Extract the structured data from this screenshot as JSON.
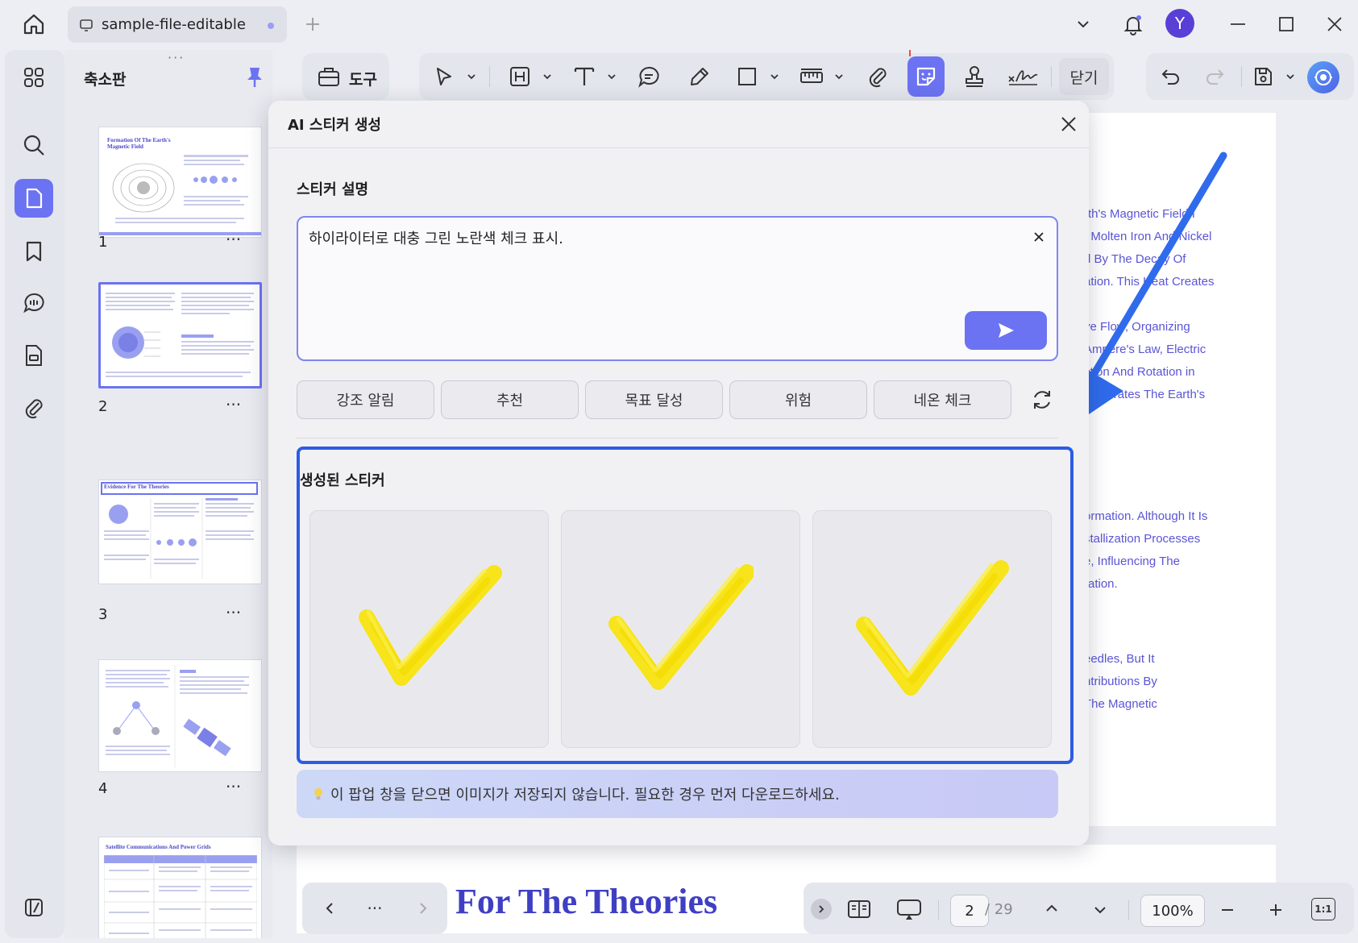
{
  "window": {
    "tab_title": "sample-file-editable",
    "avatar_initial": "Y"
  },
  "thumbnail_panel": {
    "title": "축소판",
    "pages": [
      {
        "number": "1",
        "heading": "Formation Of The Earth's Magnetic Field"
      },
      {
        "number": "2",
        "heading": ""
      },
      {
        "number": "3",
        "heading": "Evidence For The Theories"
      },
      {
        "number": "4",
        "heading": ""
      },
      {
        "number": "",
        "heading": "Satellite Communications And Power Grids"
      }
    ],
    "more_label": "···"
  },
  "toolbar": {
    "tools_label": "도구",
    "close_label": "닫기"
  },
  "document": {
    "lines_top": [
      "rth's Magnetic Field I",
      "f Molten Iron And Nickel",
      "d By The Decay Of",
      "ation. This Heat Creates",
      "ve Flow, Organizing",
      "Ampere's Law, Electric",
      "ction And Rotation in",
      "Generates The Earth's"
    ],
    "lines_mid": [
      "ormation. Although It Is",
      "stallization Processes",
      "e, Influencing The",
      "ration."
    ],
    "lines_bottom": [
      "eedles, But It",
      "ntributions By",
      "The Magnetic"
    ],
    "big_heading": "For The Theories"
  },
  "dialog": {
    "title": "AI 스티커 생성",
    "description_label": "스티커 설명",
    "description_value": "하이라이터로 대충 그린 노란색 체크 표시.",
    "suggestions": [
      "강조 알림",
      "추천",
      "목표 달성",
      "위험",
      "네온 체크"
    ],
    "generated_label": "생성된 스티커",
    "notice": "이 팝업 창을 닫으면 이미지가 저장되지 않습니다. 필요한 경우 먼저 다운로드하세요.",
    "sticker_color": "#f7e41a"
  },
  "bottom_bar": {
    "current_page": "2",
    "total_pages": "/ 29",
    "zoom": "100%",
    "fit_label": "1:1"
  },
  "colors": {
    "accent": "#6b73f2",
    "selection_blue": "#2c5ce6",
    "doc_text": "#5a55d6"
  }
}
